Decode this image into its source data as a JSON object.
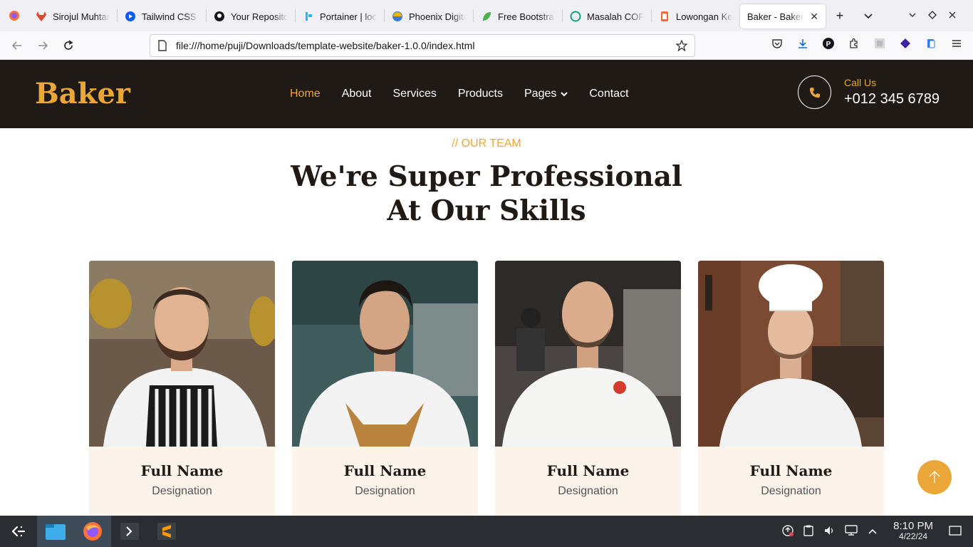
{
  "browser": {
    "tabs": [
      {
        "title": "Sirojul Muhtar",
        "color": "#e24329"
      },
      {
        "title": "Tailwind CSS",
        "color": "#0a5cf5"
      },
      {
        "title": "Your Repositories",
        "color": "#181717"
      },
      {
        "title": "Portainer | local",
        "color": "#13bef9"
      },
      {
        "title": "Phoenix Digital",
        "color": "#3a7bd5"
      },
      {
        "title": "Free Bootstrap",
        "color": "#4caf50"
      },
      {
        "title": "Masalah CORS",
        "color": "#10a37f"
      },
      {
        "title": "Lowongan Kerja",
        "color": "#f06a35"
      }
    ],
    "active_tab": {
      "title": "Baker - Bakery",
      "close": "✕"
    },
    "new_tab": "+",
    "url": "file:///home/puji/Downloads/template-website/baker-1.0.0/index.html"
  },
  "site": {
    "brand": "Baker",
    "menu": [
      "Home",
      "About",
      "Services",
      "Products",
      "Pages",
      "Contact"
    ],
    "active_menu": "Home",
    "call_label": "Call Us",
    "call_number": "+012 345 6789",
    "accent_color": "#eaa636",
    "header_bg": "#201a16"
  },
  "team": {
    "eyebrow": "// OUR TEAM",
    "heading_line1": "We're Super Professional",
    "heading_line2": "At Our Skills",
    "members": [
      {
        "name": "Full Name",
        "role": "Designation"
      },
      {
        "name": "Full Name",
        "role": "Designation"
      },
      {
        "name": "Full Name",
        "role": "Designation"
      },
      {
        "name": "Full Name",
        "role": "Designation"
      }
    ]
  },
  "taskbar": {
    "time": "8:10 PM",
    "date": "4/22/24"
  }
}
